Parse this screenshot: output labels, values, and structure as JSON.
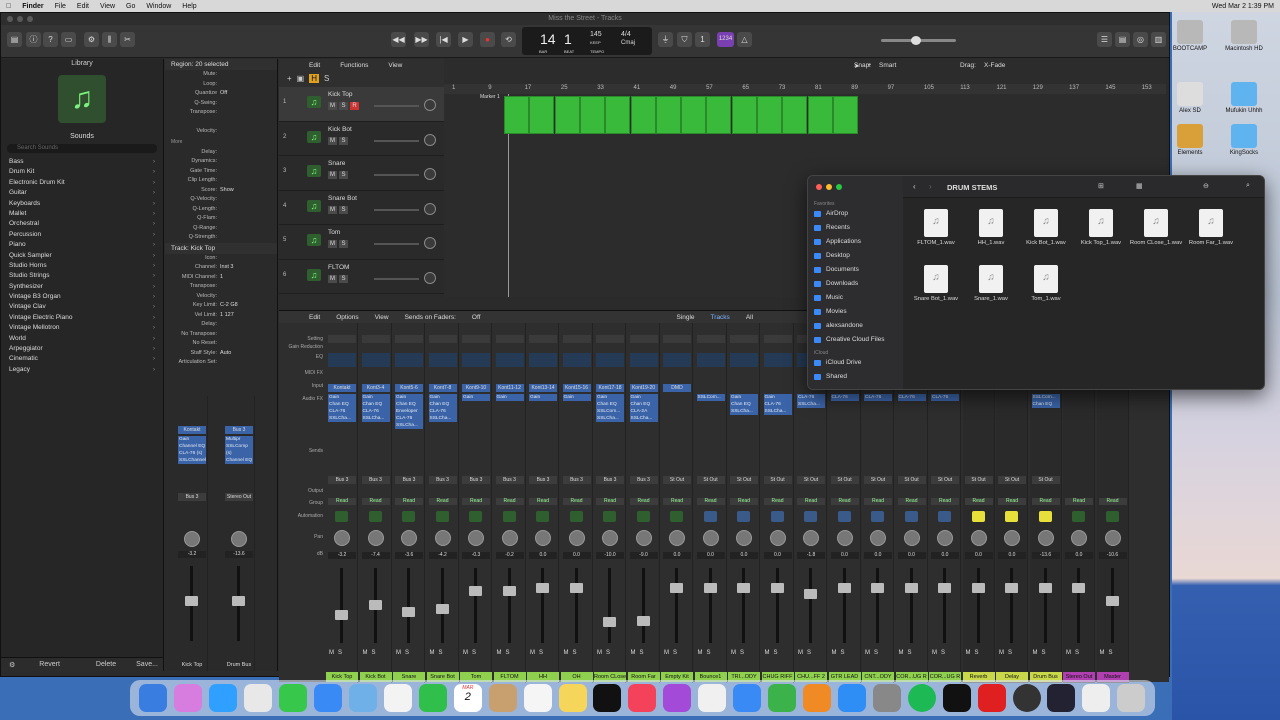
{
  "menubar": {
    "items": [
      "Finder",
      "File",
      "Edit",
      "View",
      "Go",
      "Window",
      "Help"
    ],
    "clock": "Wed Mar 2  1:39 PM"
  },
  "window": {
    "title": "Miss the Street - Tracks"
  },
  "transport": {
    "bar": "14",
    "beat": "1",
    "tempo": "145",
    "tempo_label": "KEEP",
    "timesig": "4/4",
    "key": "Cmaj",
    "bar_label": "BAR",
    "beat_label": "BEAT",
    "tempo_sub": "TEMPO",
    "counter": "1234"
  },
  "library": {
    "title": "Library",
    "sounds": "Sounds",
    "search": "Search Sounds",
    "categories": [
      "Bass",
      "Drum Kit",
      "Electronic Drum Kit",
      "Guitar",
      "Keyboards",
      "Mallet",
      "Orchestral",
      "Percussion",
      "Piano",
      "Quick Sampler",
      "Studio Horns",
      "Studio Strings",
      "Synthesizer",
      "Vintage B3 Organ",
      "Vintage Clav",
      "Vintage Electric Piano",
      "Vintage Mellotron",
      "World",
      "Arpeggiator",
      "Cinematic",
      "Legacy"
    ],
    "footer": {
      "revert": "Revert",
      "delete": "Delete",
      "save": "Save..."
    }
  },
  "inspector": {
    "region_title": "Region: 20 selected",
    "region_rows": [
      [
        "Mute:",
        ""
      ],
      [
        "Loop:",
        ""
      ],
      [
        "Quantize",
        "Off"
      ],
      [
        "Q-Swing:",
        ""
      ],
      [
        "Transpose:",
        ""
      ],
      [
        "",
        ""
      ],
      [
        "Velocity:",
        ""
      ]
    ],
    "more": "More",
    "more_rows": [
      [
        "Delay:",
        ""
      ],
      [
        "Dynamics:",
        ""
      ],
      [
        "Gate Time:",
        ""
      ],
      [
        "Clip Length:",
        ""
      ],
      [
        "Score:",
        "Show"
      ],
      [
        "Q-Velocity:",
        ""
      ],
      [
        "Q-Length:",
        ""
      ],
      [
        "Q-Flam:",
        ""
      ],
      [
        "Q-Range:",
        ""
      ],
      [
        "Q-Strength:",
        ""
      ]
    ],
    "track_title": "Track: Kick Top",
    "track_rows": [
      [
        "Icon:",
        ""
      ],
      [
        "Channel:",
        "Inst 3"
      ],
      [
        "MIDI Channel:",
        "1"
      ],
      [
        "Transpose:",
        ""
      ],
      [
        "Velocity:",
        ""
      ],
      [
        "Key Limit:",
        "C-2  G8"
      ],
      [
        "Vel Limit:",
        "1  127"
      ],
      [
        "Delay:",
        ""
      ],
      [
        "No Transpose:",
        ""
      ],
      [
        "No Reset:",
        ""
      ],
      [
        "Staff Style:",
        "Auto"
      ],
      [
        "Articulation Set:",
        ""
      ]
    ]
  },
  "arrange_toolbar": {
    "edit": "Edit",
    "functions": "Functions",
    "view": "View",
    "snap_label": "Snap:",
    "snap": "Smart",
    "drag_label": "Drag:",
    "drag": "X-Fade"
  },
  "ruler": [
    "1",
    "9",
    "17",
    "25",
    "33",
    "41",
    "49",
    "57",
    "65",
    "73",
    "81",
    "89",
    "97",
    "105",
    "113",
    "121",
    "129",
    "137",
    "145",
    "153"
  ],
  "marker": "Marker 1",
  "tracks": [
    {
      "num": "1",
      "name": "Kick Top"
    },
    {
      "num": "2",
      "name": "Kick Bot"
    },
    {
      "num": "3",
      "name": "Snare"
    },
    {
      "num": "4",
      "name": "Snare Bot"
    },
    {
      "num": "5",
      "name": "Tom"
    },
    {
      "num": "6",
      "name": "FLTOM"
    }
  ],
  "mixer_toolbar": {
    "edit": "Edit",
    "options": "Options",
    "view": "View",
    "sends": "Sends on Faders:",
    "sends_val": "Off",
    "single": "Single",
    "tracks": "Tracks",
    "all": "All"
  },
  "mixer_labels": [
    "Setting",
    "Gain Reduction",
    "EQ",
    "MIDI FX",
    "Input",
    "Audio FX",
    "",
    "Sends",
    "",
    "Output",
    "Group",
    "Automation",
    "",
    "Pan",
    "dB"
  ],
  "strips": [
    {
      "name": "Kick Top",
      "input": "Kontakt",
      "plugins": [
        "Gain",
        "Chan EQ",
        "CLA-76",
        "SSLCha..."
      ],
      "output": "Bus 3",
      "auto": "Read",
      "vol": "-3.2",
      "fader": 60,
      "color": "#8fd14f"
    },
    {
      "name": "Kick Bot",
      "input": "Kont3-4",
      "plugins": [
        "Gain",
        "Chan EQ",
        "CLA-76",
        "SSLCha..."
      ],
      "output": "Bus 3",
      "auto": "Read",
      "vol": "-7.4",
      "fader": 45,
      "color": "#8fd14f"
    },
    {
      "name": "Snare",
      "input": "Kont5-6",
      "plugins": [
        "Gain",
        "Chan EQ",
        "Enveloper",
        "CLA-76",
        "SSLCha..."
      ],
      "output": "Bus 3",
      "auto": "Read",
      "vol": "-3.6",
      "fader": 55,
      "color": "#8fd14f"
    },
    {
      "name": "Snare Bot",
      "input": "Kont7-8",
      "plugins": [
        "Gain",
        "Chan EQ",
        "CLA-76",
        "SSLCha..."
      ],
      "output": "Bus 3",
      "auto": "Read",
      "vol": "-4.2",
      "fader": 52,
      "color": "#8fd14f"
    },
    {
      "name": "Tom",
      "input": "Kont9-10",
      "plugins": [
        "Gain"
      ],
      "output": "Bus 3",
      "auto": "Read",
      "vol": "-0.3",
      "fader": 25,
      "color": "#8fd14f"
    },
    {
      "name": "FLTOM",
      "input": "Kont11-12",
      "plugins": [
        "Gain"
      ],
      "output": "Bus 3",
      "auto": "Read",
      "vol": "-0.2",
      "fader": 25,
      "color": "#8fd14f"
    },
    {
      "name": "HH",
      "input": "Kont13-14",
      "plugins": [
        "Gain"
      ],
      "output": "Bus 3",
      "auto": "Read",
      "vol": "0.0",
      "fader": 22,
      "color": "#8fd14f"
    },
    {
      "name": "OH",
      "input": "Kont15-16",
      "plugins": [
        "Gain"
      ],
      "output": "Bus 3",
      "auto": "Read",
      "vol": "0.0",
      "fader": 22,
      "color": "#8fd14f"
    },
    {
      "name": "Room CLose",
      "input": "Kont17-18",
      "plugins": [
        "Gain",
        "Chan EQ",
        "SSLCom...",
        "SSLCha..."
      ],
      "output": "Bus 3",
      "auto": "Read",
      "vol": "-10.0",
      "fader": 70,
      "color": "#8fd14f"
    },
    {
      "name": "Room Far",
      "input": "Kont19-20",
      "plugins": [
        "Gain",
        "Chan EQ",
        "CLA-2A",
        "SSLCha..."
      ],
      "output": "Bus 3",
      "auto": "Read",
      "vol": "-9.0",
      "fader": 68,
      "color": "#8fd14f"
    },
    {
      "name": "Empty Kit",
      "input": "DMD",
      "plugins": [],
      "output": "St Out",
      "auto": "Read",
      "vol": "0.0",
      "fader": 22,
      "color": "#8fd14f"
    },
    {
      "name": "Bounce1",
      "input": "",
      "plugins": [
        "SSLCom..."
      ],
      "output": "St Out",
      "auto": "Read",
      "vol": "0.0",
      "fader": 22,
      "color": "#8fd14f"
    },
    {
      "name": "TRI...ODY",
      "input": "",
      "plugins": [
        "Gain",
        "Chan EQ",
        "SSLCha..."
      ],
      "output": "St Out",
      "auto": "Read",
      "vol": "0.0",
      "fader": 22,
      "color": "#8fd14f"
    },
    {
      "name": "CHUG RIFF",
      "input": "",
      "plugins": [
        "Gain",
        "CLA-76",
        "SSLCha..."
      ],
      "output": "St Out",
      "auto": "Read",
      "vol": "0.0",
      "fader": 22,
      "color": "#8fd14f"
    },
    {
      "name": "CHU...FF 2",
      "input": "",
      "plugins": [
        "CLA-76",
        "SSLCha..."
      ],
      "output": "St Out",
      "auto": "Read",
      "vol": "-1.8",
      "fader": 30,
      "color": "#8fd14f"
    },
    {
      "name": "GTR LEAD",
      "input": "",
      "plugins": [
        "CLA-76"
      ],
      "output": "St Out",
      "auto": "Read",
      "vol": "0.0",
      "fader": 22,
      "color": "#8fd14f"
    },
    {
      "name": "CNT...ODY",
      "input": "",
      "plugins": [
        "CLA-76"
      ],
      "output": "St Out",
      "auto": "Read",
      "vol": "0.0",
      "fader": 22,
      "color": "#8fd14f"
    },
    {
      "name": "COR...UG R",
      "input": "",
      "plugins": [
        "CLA-76"
      ],
      "output": "St Out",
      "auto": "Read",
      "vol": "0.0",
      "fader": 22,
      "color": "#8fd14f"
    },
    {
      "name": "COR...UG R",
      "input": "",
      "plugins": [
        "CLA-76"
      ],
      "output": "St Out",
      "auto": "Read",
      "vol": "0.0",
      "fader": 22,
      "color": "#8fd14f"
    },
    {
      "name": "Reverb",
      "input": "",
      "plugins": [],
      "output": "St Out",
      "auto": "Read",
      "vol": "0.0",
      "fader": 22,
      "color": "#c9d84a"
    },
    {
      "name": "Delay",
      "input": "",
      "plugins": [],
      "output": "St Out",
      "auto": "Read",
      "vol": "0.0",
      "fader": 22,
      "color": "#c9d84a"
    },
    {
      "name": "Drum Bus",
      "input": "",
      "plugins": [
        "SSLCom...",
        "Chan EQ"
      ],
      "output": "St Out",
      "auto": "Read",
      "vol": "-13.6",
      "fader": 22,
      "color": "#c9d84a"
    },
    {
      "name": "Stereo Out",
      "input": "",
      "plugins": [],
      "output": "",
      "auto": "Read",
      "vol": "0.0",
      "fader": 22,
      "color": "#b03fb0"
    },
    {
      "name": "Master",
      "input": "",
      "plugins": [],
      "output": "",
      "auto": "Read",
      "vol": "-10.6",
      "fader": 40,
      "color": "#b03fb0"
    }
  ],
  "inspector_strips": [
    {
      "name": "Kick Top",
      "input": "Kontakt",
      "plugins": [
        "Gain",
        "Channel EQ",
        "CLA-76 (s)",
        "SSLChannel"
      ],
      "output": "Bus 3",
      "vol": "-3.2"
    },
    {
      "name": "Drum Bus",
      "input": "Bus 3",
      "plugins": [
        "Multipr",
        "SSLComp (s)",
        "Channel EQ"
      ],
      "output": "Stereo Out",
      "vol": "-13.6"
    }
  ],
  "finder": {
    "title": "DRUM STEMS",
    "sidebar": {
      "favorites": "Favorites",
      "icloud": "iCloud",
      "items": [
        "AirDrop",
        "Recents",
        "Applications",
        "Desktop",
        "Documents",
        "Downloads",
        "Music",
        "Movies",
        "alexsandone",
        "Creative Cloud Files"
      ],
      "icloud_items": [
        "iCloud Drive",
        "Shared"
      ]
    },
    "files": [
      "FLTOM_1.wav",
      "HH_1.wav",
      "Kick Bot_1.wav",
      "Kick Top_1.wav",
      "Room CLose_1.wav",
      "Room Far_1.wav",
      "Snare Bot_1.wav",
      "Snare_1.wav",
      "Tom_1.wav"
    ]
  },
  "desktop": [
    "BOOTCAMP",
    "Macintosh HD",
    "Alex SD",
    "Mufukin Uhhh",
    "Elements",
    "KingSocks"
  ],
  "dock": {
    "calendar_month": "MAR",
    "calendar_day": "2"
  }
}
